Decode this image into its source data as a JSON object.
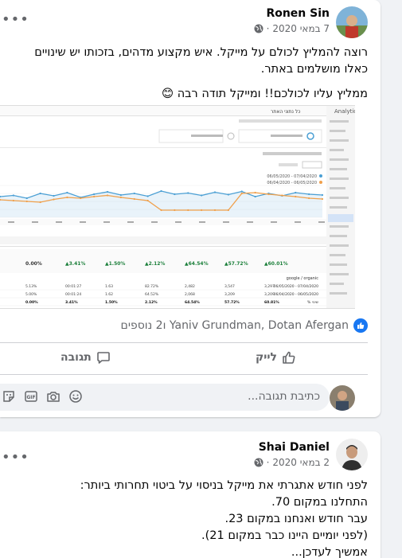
{
  "post1": {
    "author": "Ronen Sin",
    "date": "7 במאי 2020",
    "privacy_icon": "globe-icon",
    "text_p1": "רוצה להמליץ לכולם על מייקל. איש מקצוע מדהים, בזכותו יש שינויים כאלו מושלמים באתר.",
    "text_p2": "ממליץ עליו לכולכם!! ומייקל תודה רבה 😊",
    "more_icon": "more-options-icon",
    "screenshot": {
      "app_title": "Analytics",
      "menu_button": "כל נתוני האתר",
      "summary_cells": [
        "60.01%",
        "57.72%",
        "64.54%",
        "2.12%",
        "1.50%",
        "3.41%",
        "0.00%"
      ],
      "chart_dates": [
        "06/05/2020 - 07/04/2020",
        "06/04/2020 - 06/05/2020"
      ],
      "table_rows": [
        [
          "3,297",
          "3,547",
          "2,482",
          "82.72%",
          "1.63",
          "00:01:27",
          "5.13%"
        ],
        [
          "3,209",
          "3,209",
          "2,068",
          "64.52%",
          "1.62",
          "00:01:24",
          "5.00%"
        ],
        [
          "60.81%",
          "57.72%",
          "64.54%",
          "2.12%",
          "1.50%",
          "3.41%",
          "0.00%"
        ]
      ],
      "row_labels": [
        "google / organic",
        "06/05/2020 - 07/04/2020",
        "06/04/2020 - 06/05/2020",
        "% שינוי"
      ]
    },
    "chart_data": {
      "type": "line",
      "series": [
        {
          "color": "#4a9fd4",
          "values": [
            52,
            55,
            48,
            60,
            54,
            62,
            50,
            58,
            64,
            56,
            60,
            53,
            66,
            58,
            61,
            55,
            63,
            57,
            65,
            52,
            60,
            54,
            62,
            58,
            56
          ]
        },
        {
          "color": "#f0a04b",
          "values": [
            44,
            42,
            40,
            38,
            45,
            50,
            48,
            52,
            55,
            50,
            46,
            42,
            18,
            18,
            18,
            18,
            18,
            18,
            60,
            62,
            58,
            55,
            52,
            48,
            46
          ]
        }
      ],
      "ylim": [
        0,
        80
      ],
      "grid": true
    },
    "reactions": {
      "text": "Yaniv Grundman, Dotan Afergan ו2 נוספים",
      "icon": "like-badge-icon"
    },
    "actions": {
      "like_label": "לייק",
      "comment_label": "תגובה"
    },
    "comment": {
      "placeholder": "כתיבת תגובה...",
      "icons": [
        "sticker-icon",
        "gif-icon",
        "camera-icon",
        "emoji-icon"
      ]
    }
  },
  "post2": {
    "author": "Shai Daniel",
    "date": "2 במאי 2020",
    "privacy_icon": "globe-icon",
    "lines": [
      "לפני חודש אתגרתי את מייקל בניסוי על ביטוי תחרותי ביותר:",
      "התחלנו במקום 70.",
      "עבר חודש ואנחנו במקום 23.",
      "(לפני יומיים היינו כבר במקום 21).",
      "אמשיך לעדכן..."
    ]
  }
}
